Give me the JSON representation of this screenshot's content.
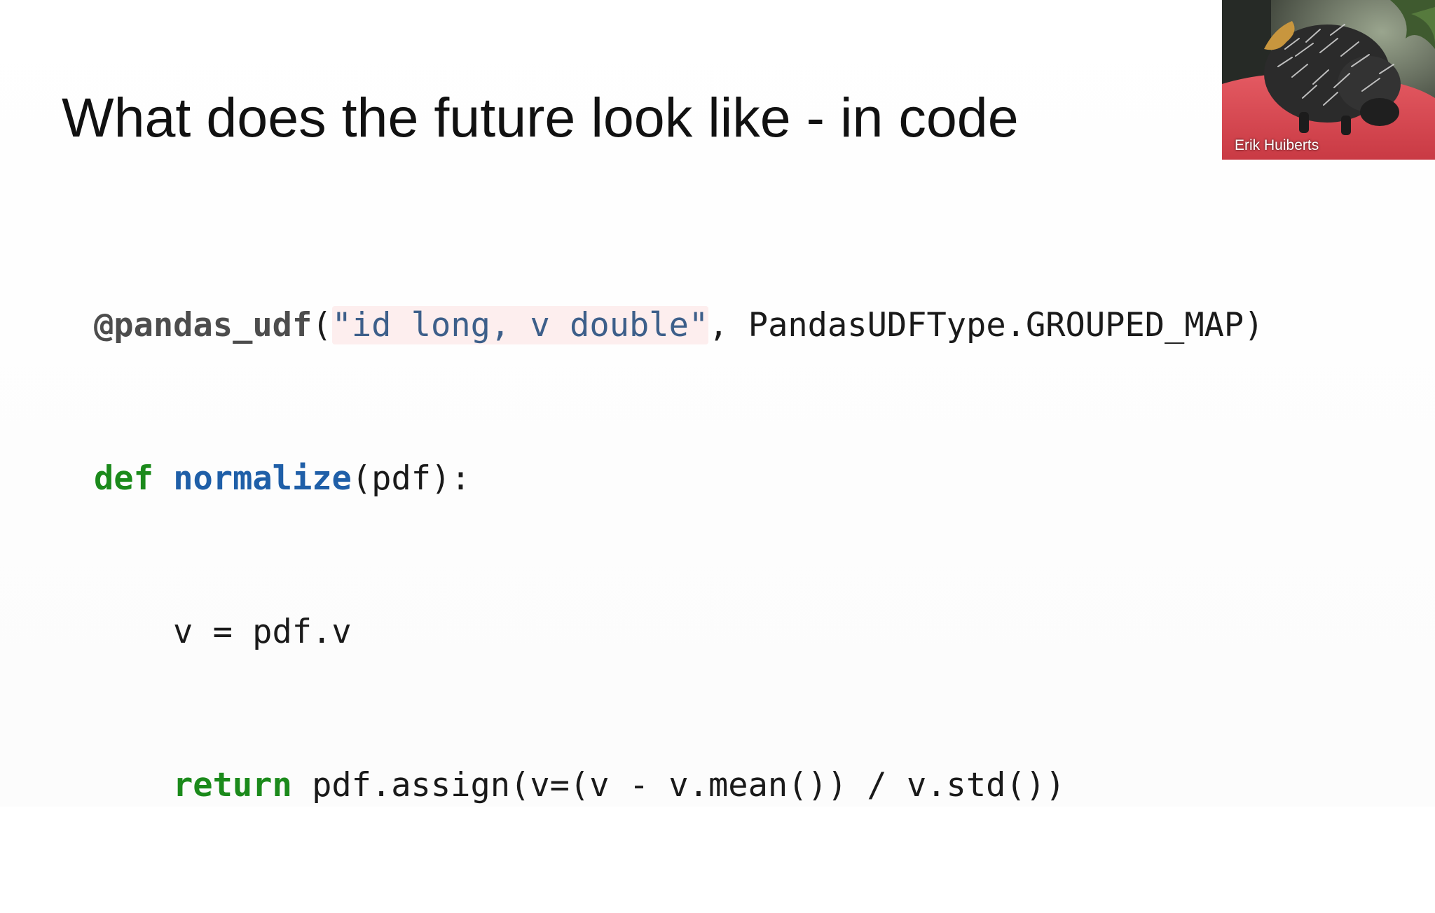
{
  "slide": {
    "title": "What does the future look like - in code",
    "code": {
      "line1": {
        "decorator": "@pandas_udf",
        "open_paren": "(",
        "string": "\"id long, v double\"",
        "rest": ", PandasUDFType.GROUPED_MAP)"
      },
      "line2": {
        "keyword": "def",
        "funcname": "normalize",
        "rest": "(pdf):"
      },
      "line3": {
        "text": "v = pdf.v"
      },
      "line4": {
        "keyword": "return",
        "rest": " pdf.assign(v=(v - v.mean()) / v.std())"
      }
    },
    "colors": {
      "keyword": "#1b8a1b",
      "funcname": "#1f5fa8",
      "string": "#3d5f8a",
      "string_highlight": "#fdeeee"
    }
  },
  "webcam": {
    "participant_name": "Erik Huiberts",
    "subject_icon": "porcupine-photo"
  }
}
